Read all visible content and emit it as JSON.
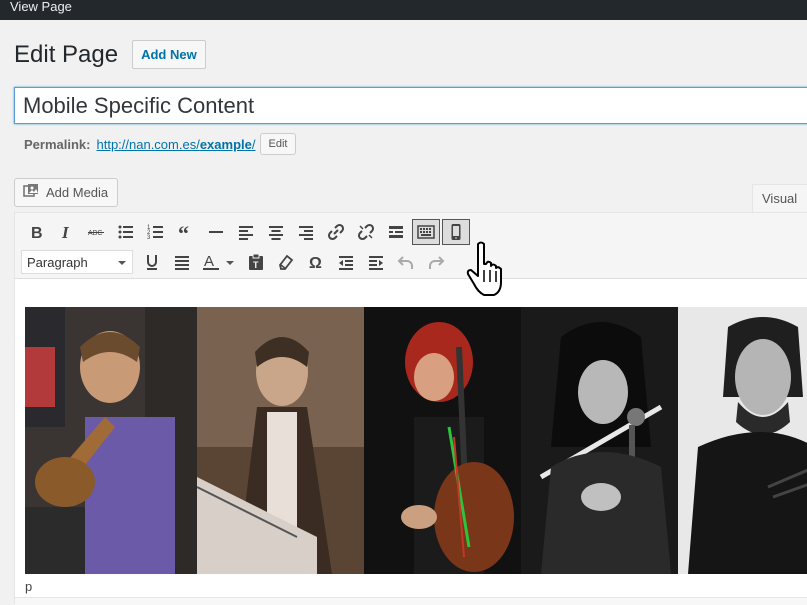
{
  "adminbar": {
    "view_page": "View Page"
  },
  "header": {
    "title": "Edit Page",
    "add_new": "Add New"
  },
  "post": {
    "title": "Mobile Specific Content"
  },
  "permalink": {
    "label": "Permalink:",
    "url_prefix": "http://nan.com.es/",
    "slug": "example",
    "url_suffix": "/",
    "edit": "Edit"
  },
  "media": {
    "add_media": "Add Media"
  },
  "editor": {
    "tab_visual": "Visual",
    "format_selected": "Paragraph",
    "path": "p"
  },
  "toolbar_row1_icons": [
    "bold-icon",
    "italic-icon",
    "strikethrough-icon",
    "bullet-list-icon",
    "numbered-list-icon",
    "blockquote-icon",
    "horizontal-rule-icon",
    "align-left-icon",
    "align-center-icon",
    "align-right-icon",
    "link-icon",
    "unlink-icon",
    "read-more-icon",
    "toolbar-toggle-icon",
    "mobile-content-icon"
  ],
  "toolbar_row2_icons": [
    "underline-icon",
    "justify-icon",
    "text-color-icon",
    "paste-text-icon",
    "clear-formatting-icon",
    "special-character-icon",
    "outdent-icon",
    "indent-icon",
    "undo-icon",
    "redo-icon"
  ],
  "colors": {
    "adminbar": "#23282d",
    "link": "#0073aa",
    "focus": "#5b9dd9"
  }
}
